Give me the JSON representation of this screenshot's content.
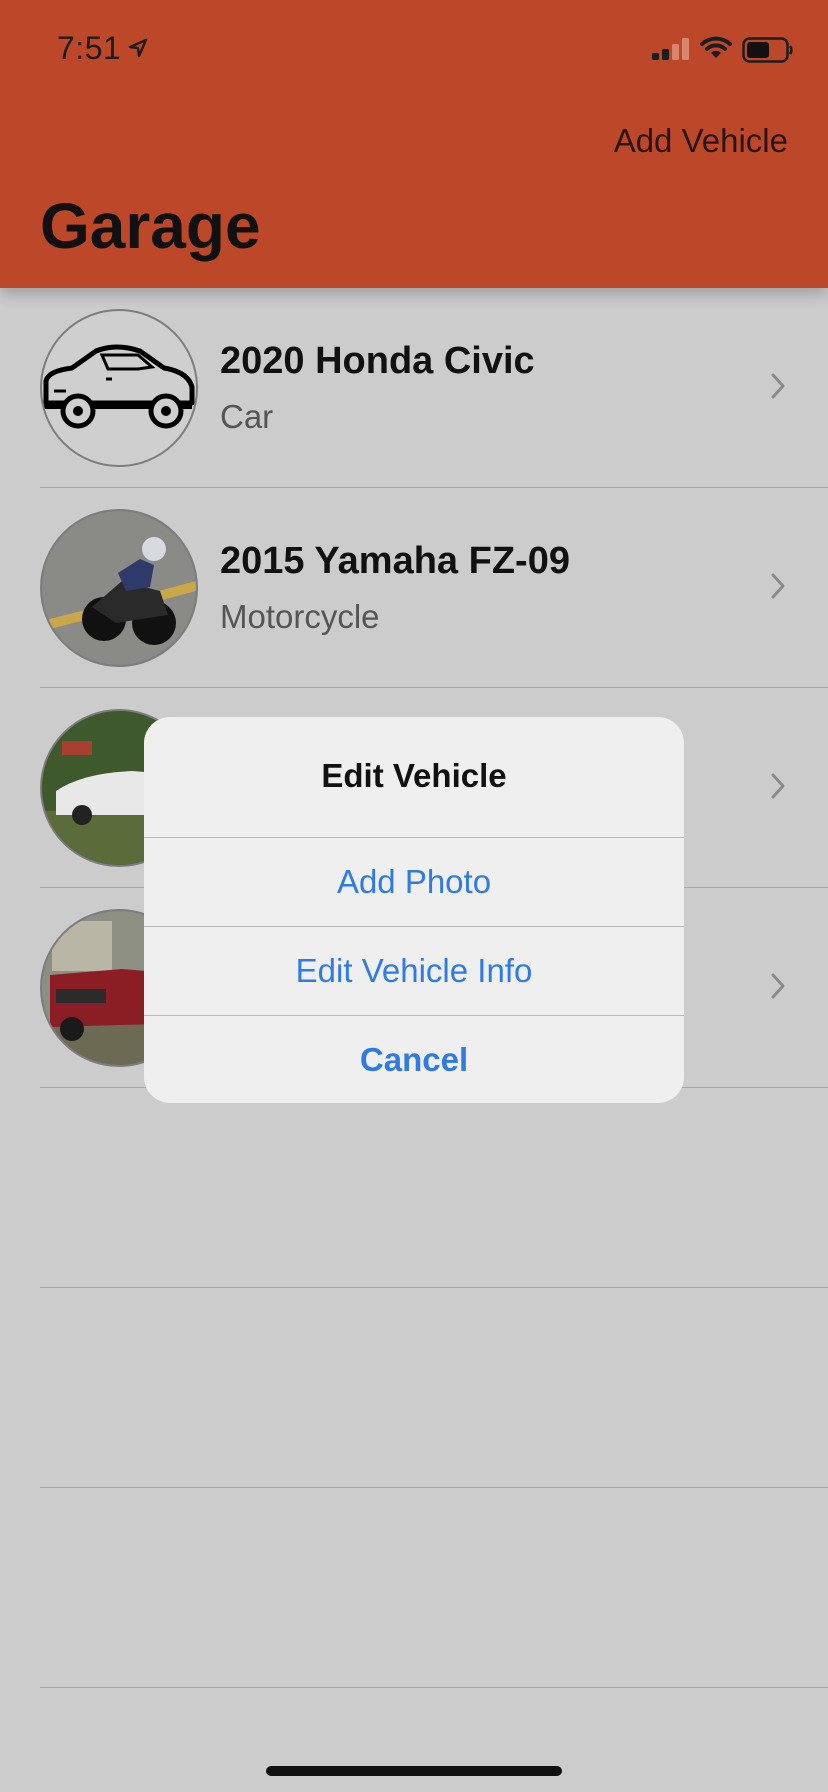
{
  "status_bar": {
    "time": "7:51"
  },
  "nav": {
    "add_vehicle_label": "Add Vehicle",
    "title": "Garage"
  },
  "vehicles": [
    {
      "title": "2020 Honda Civic",
      "type": "Car"
    },
    {
      "title": "2015 Yamaha FZ-09",
      "type": "Motorcycle"
    }
  ],
  "alert": {
    "title": "Edit Vehicle",
    "actions": [
      "Add Photo",
      "Edit Vehicle Info",
      "Cancel"
    ]
  },
  "colors": {
    "header": "#bd4829",
    "accent": "#2f7be2",
    "background": "#cccccc"
  }
}
